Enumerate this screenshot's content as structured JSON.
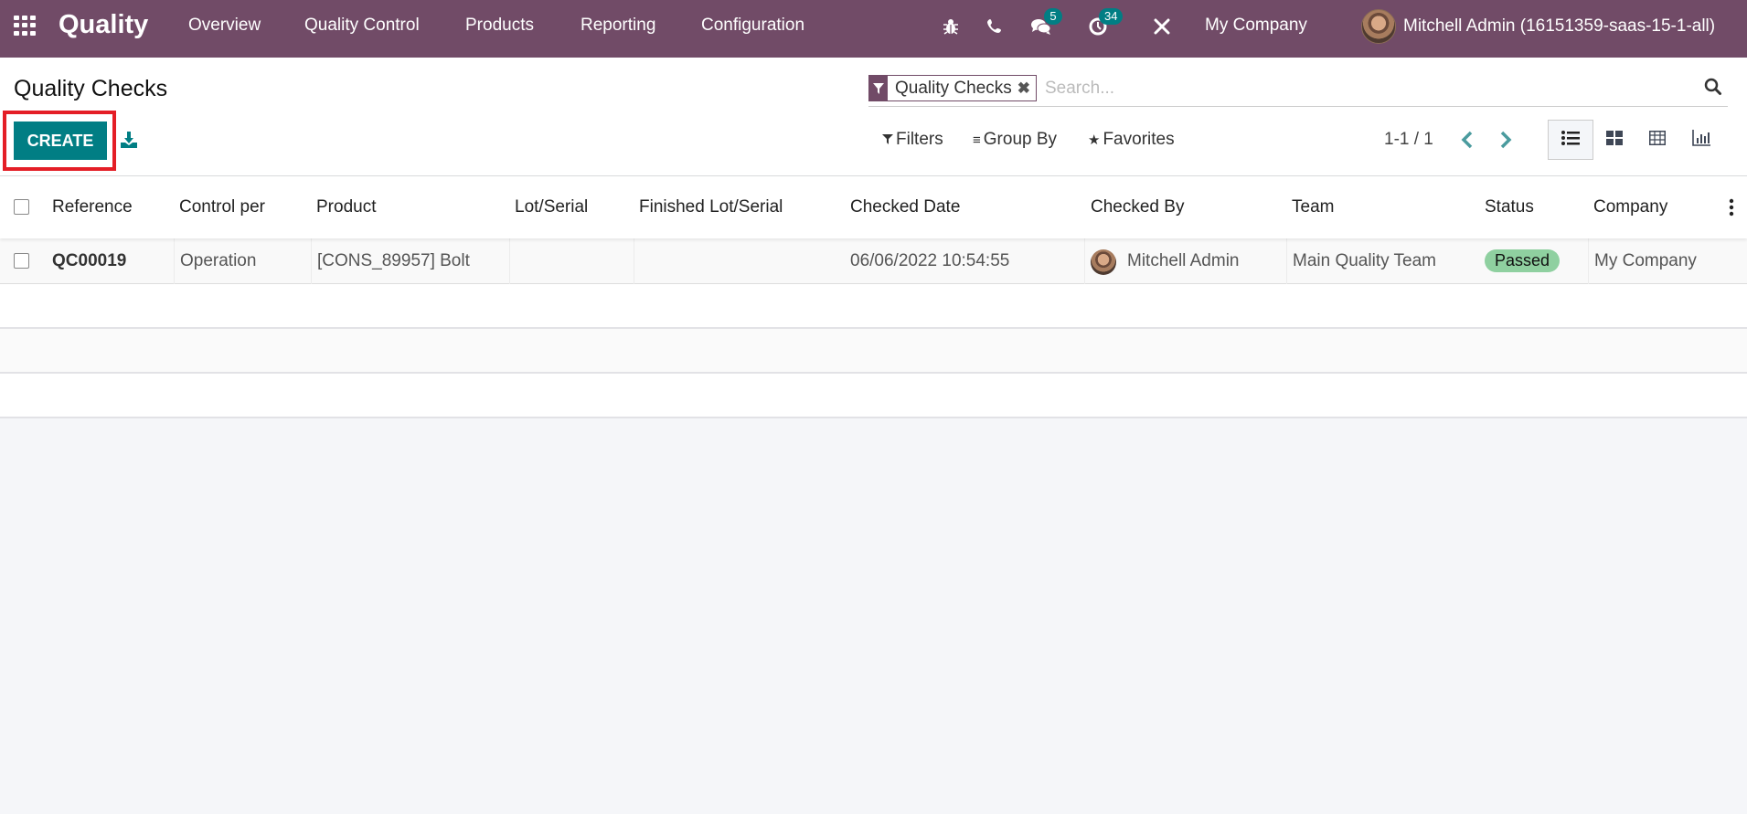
{
  "navbar": {
    "app_name": "Quality",
    "menu": [
      "Overview",
      "Quality Control",
      "Products",
      "Reporting",
      "Configuration"
    ],
    "icons": {
      "debug": "bug-icon",
      "phone": "phone-icon",
      "messages": "chat-icon",
      "activities": "clock-icon",
      "tools": "tools-icon"
    },
    "messages_count": "5",
    "activities_count": "34",
    "company": "My Company",
    "user": "Mitchell Admin (16151359-saas-15-1-all)"
  },
  "control_panel": {
    "title": "Quality Checks",
    "create_label": "CREATE",
    "search": {
      "facet_label": "Quality Checks",
      "placeholder": "Search..."
    },
    "filters_label": "Filters",
    "group_by_label": "Group By",
    "favorites_label": "Favorites",
    "pager": "1-1 / 1",
    "views": [
      "list",
      "kanban",
      "pivot",
      "graph"
    ],
    "active_view": "list"
  },
  "table": {
    "columns": [
      "Reference",
      "Control per",
      "Product",
      "Lot/Serial",
      "Finished Lot/Serial",
      "Checked Date",
      "Checked By",
      "Team",
      "Status",
      "Company"
    ],
    "rows": [
      {
        "reference": "QC00019",
        "control_per": "Operation",
        "product": "[CONS_89957] Bolt",
        "lot_serial": "",
        "finished_lot_serial": "",
        "checked_date": "06/06/2022 10:54:55",
        "checked_by": "Mitchell Admin",
        "team": "Main Quality Team",
        "status": "Passed",
        "company": "My Company"
      }
    ]
  },
  "colors": {
    "brand": "#714b67",
    "primary": "#017e84",
    "status_passed": "#8fd0a0",
    "highlight": "#e41e26"
  }
}
